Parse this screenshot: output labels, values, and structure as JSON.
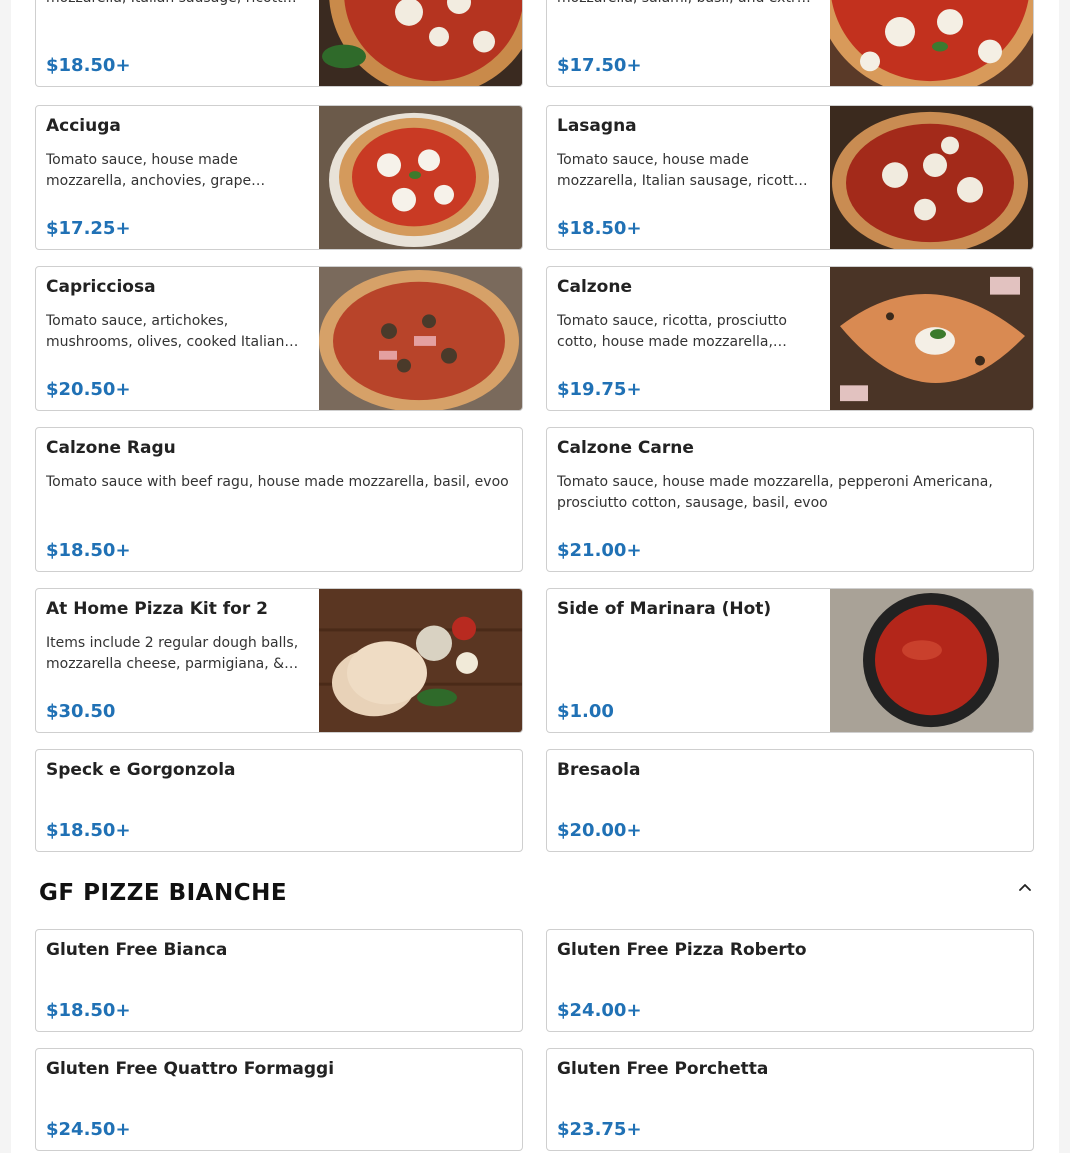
{
  "top_row": [
    {
      "desc": "Tomato sauce, house made mozzarella, Italian sausage, ricotta, basil, evoo",
      "price": "$18.50+"
    },
    {
      "desc": "Tomato sauce, house made mozzarella, salami, basil, and extra virgin olive oil",
      "price": "$17.50+"
    }
  ],
  "pizze": [
    {
      "name": "Acciuga",
      "desc": "Tomato sauce, house made mozzarella, anchovies, grape tomatoes, olives, basil",
      "price": "$17.25+",
      "image": "pizza-acciuga-photo"
    },
    {
      "name": "Lasagna",
      "desc": "Tomato sauce, house made mozzarella, Italian sausage, ricotta, beef ragu, basil",
      "price": "$18.50+",
      "image": "pizza-lasagna-photo"
    },
    {
      "name": "Capricciosa",
      "desc": "Tomato sauce, artichokes, mushrooms, olives, cooked Italian ham, mozzarella",
      "price": "$20.50+",
      "image": "pizza-capricciosa-photo"
    },
    {
      "name": "Calzone",
      "desc": "Tomato sauce, ricotta, prosciutto cotto, house made mozzarella, basil, evoo",
      "price": "$19.75+",
      "image": "calzone-photo"
    },
    {
      "name": "Calzone Ragu",
      "desc": "Tomato sauce with beef ragu, house made mozzarella, basil, evoo",
      "price": "$18.50+"
    },
    {
      "name": "Calzone Carne",
      "desc": "Tomato sauce, house made mozzarella, pepperoni Americana, prosciutto cotton, sausage, basil, evoo",
      "price": "$21.00+"
    },
    {
      "name": "At Home Pizza Kit for 2",
      "desc": "Items include 2 regular dough balls, mozzarella cheese, parmigiana, & tomato sauce",
      "price": "$30.50",
      "image": "pizza-kit-photo"
    },
    {
      "name": "Side of Marinara (Hot)",
      "desc": "",
      "price": "$1.00",
      "image": "marinara-photo"
    },
    {
      "name": "Speck e Gorgonzola",
      "price": "$18.50+"
    },
    {
      "name": "Bresaola",
      "price": "$20.00+"
    }
  ],
  "section": {
    "title": "GF PIZZE BIANCHE",
    "toggle_icon": "chevron-up-icon"
  },
  "gf": [
    {
      "name": "Gluten Free Bianca",
      "price": "$18.50+"
    },
    {
      "name": "Gluten Free Pizza Roberto",
      "price": "$24.00+"
    },
    {
      "name": "Gluten Free Quattro Formaggi",
      "price": "$24.50+"
    },
    {
      "name": "Gluten Free Porchetta",
      "price": "$23.75+"
    }
  ],
  "colors": {
    "price": "#2071b5",
    "card_border": "#cfcfcf"
  }
}
